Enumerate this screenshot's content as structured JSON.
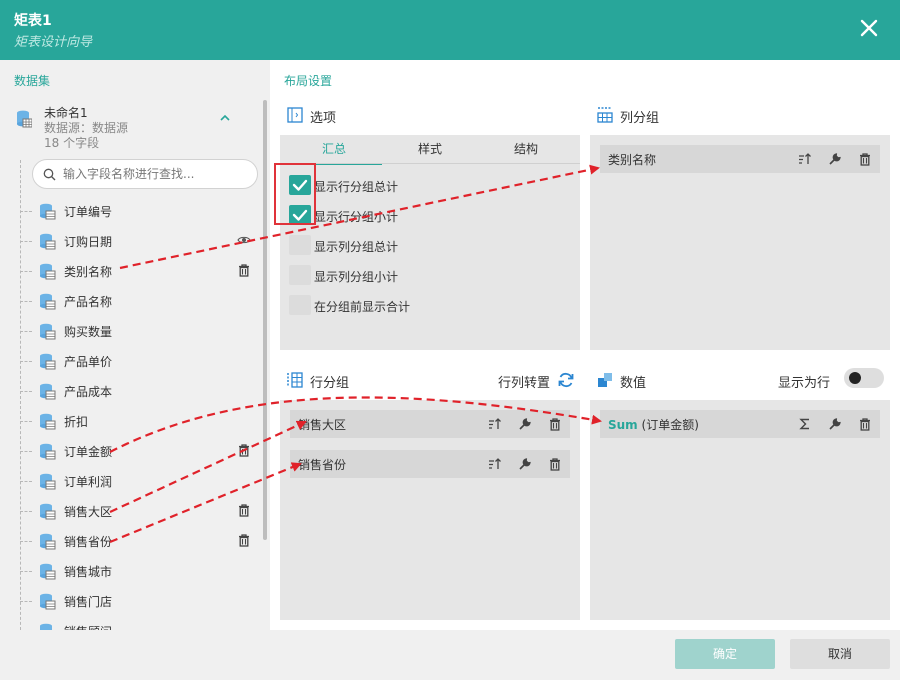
{
  "dialog": {
    "title": "矩表1",
    "subtitle": "矩表设计向导"
  },
  "left": {
    "title": "数据集",
    "dataset": {
      "name": "未命名1",
      "source": "数据源：数据源",
      "count": "18 个字段"
    },
    "search": {
      "placeholder": "输入字段名称进行查找..."
    },
    "fields": [
      {
        "label": "订单编号",
        "action": ""
      },
      {
        "label": "订购日期",
        "action": "eye-icon"
      },
      {
        "label": "类别名称",
        "action": "trash-icon"
      },
      {
        "label": "产品名称",
        "action": ""
      },
      {
        "label": "购买数量",
        "action": ""
      },
      {
        "label": "产品单价",
        "action": ""
      },
      {
        "label": "产品成本",
        "action": ""
      },
      {
        "label": "折扣",
        "action": ""
      },
      {
        "label": "订单金额",
        "action": "trash-icon"
      },
      {
        "label": "订单利润",
        "action": ""
      },
      {
        "label": "销售大区",
        "action": "trash-icon"
      },
      {
        "label": "销售省份",
        "action": "trash-icon"
      },
      {
        "label": "销售城市",
        "action": ""
      },
      {
        "label": "销售门店",
        "action": ""
      },
      {
        "label": "销售顾问",
        "action": ""
      }
    ]
  },
  "right": {
    "title": "布局设置",
    "options": {
      "title": "选项",
      "tabs": [
        "汇总",
        "样式",
        "结构"
      ],
      "active_tab": "汇总",
      "checks": [
        {
          "label": "显示行分组总计",
          "checked": true
        },
        {
          "label": "显示行分组小计",
          "checked": true
        },
        {
          "label": "显示列分组总计",
          "checked": false
        },
        {
          "label": "显示列分组小计",
          "checked": false
        },
        {
          "label": "在分组前显示合计",
          "checked": false
        }
      ]
    },
    "col_group": {
      "title": "列分组",
      "items": [
        "类别名称"
      ]
    },
    "row_group": {
      "title": "行分组",
      "transpose": "行列转置",
      "items": [
        "销售大区",
        "销售省份"
      ]
    },
    "values": {
      "title": "数值",
      "show_as_row": "显示为行",
      "show_as_row_on": false,
      "items": [
        {
          "agg": "Sum",
          "field": "(订单金额)"
        }
      ]
    }
  },
  "footer": {
    "ok": "确定",
    "cancel": "取消"
  },
  "colors": {
    "accent": "#28a69a",
    "arrow": "#e0222a",
    "highlight": "#e0333a"
  }
}
